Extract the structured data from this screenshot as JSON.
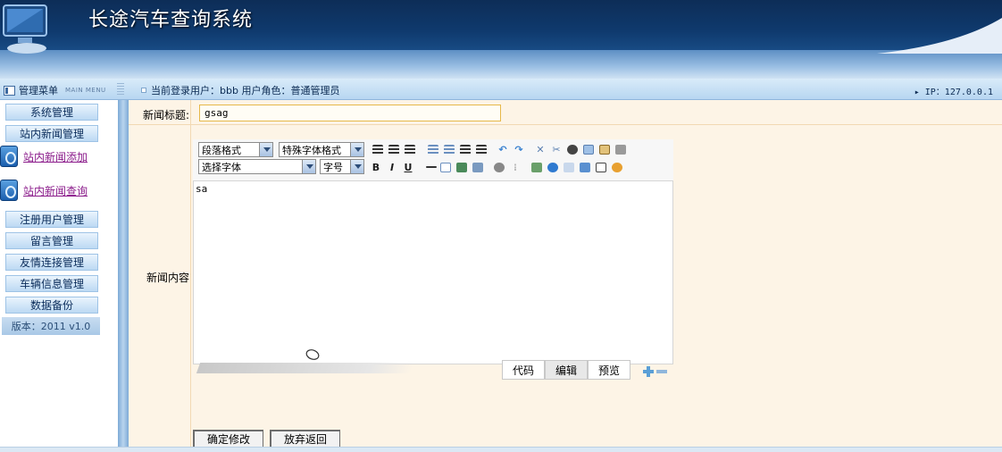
{
  "header": {
    "title": "长途汽车查询系统"
  },
  "statusbar": {
    "menu_title": "管理菜单",
    "menu_sub": "MAIN MENU",
    "login_text": "当前登录用户：bbb  用户角色：普通管理员",
    "ip_text": "IP：127.0.0.1"
  },
  "sidebar": {
    "items": [
      {
        "label": "系统管理"
      },
      {
        "label": "站内新闻管理"
      },
      {
        "label": "站内新闻添加"
      },
      {
        "label": "站内新闻查询"
      },
      {
        "label": "注册用户管理"
      },
      {
        "label": "留言管理"
      },
      {
        "label": "友情连接管理"
      },
      {
        "label": "车辆信息管理"
      },
      {
        "label": "数据备份"
      }
    ],
    "version": "版本：2011 v1.0"
  },
  "form": {
    "title_label": "新闻标题:",
    "title_value": "gsag",
    "content_label": "新闻内容",
    "editor": {
      "paragraph_format": "段落格式",
      "special_font": "特殊字体格式",
      "font_select": "选择字体",
      "font_size": "字号",
      "bold": "B",
      "italic": "I",
      "underline": "U",
      "content": "sa",
      "tabs": [
        "代码",
        "编辑",
        "预览"
      ]
    },
    "confirm_button": "确定修改",
    "cancel_button": "放弃返回"
  }
}
